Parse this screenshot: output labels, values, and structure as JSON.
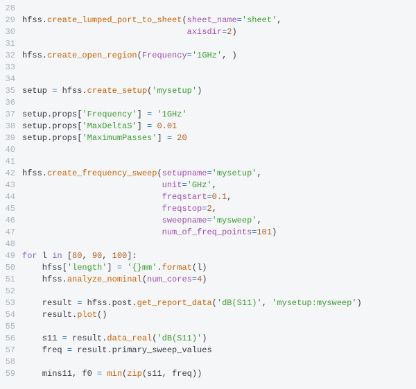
{
  "lines": [
    {
      "num": "28",
      "tokens": []
    },
    {
      "num": "29",
      "tokens": [
        {
          "c": "plain",
          "t": "hfss."
        },
        {
          "c": "fn",
          "t": "create_lumped_port_to_sheet"
        },
        {
          "c": "plain",
          "t": "("
        },
        {
          "c": "attr",
          "t": "sheet_name"
        },
        {
          "c": "op",
          "t": "="
        },
        {
          "c": "str",
          "t": "'sheet'"
        },
        {
          "c": "plain",
          "t": ","
        }
      ]
    },
    {
      "num": "30",
      "tokens": [
        {
          "c": "plain",
          "t": "                                 "
        },
        {
          "c": "attr",
          "t": "axisdir"
        },
        {
          "c": "op",
          "t": "="
        },
        {
          "c": "num",
          "t": "2"
        },
        {
          "c": "plain",
          "t": ")"
        }
      ]
    },
    {
      "num": "31",
      "tokens": []
    },
    {
      "num": "32",
      "tokens": [
        {
          "c": "plain",
          "t": "hfss."
        },
        {
          "c": "fn",
          "t": "create_open_region"
        },
        {
          "c": "plain",
          "t": "("
        },
        {
          "c": "attr",
          "t": "Frequency"
        },
        {
          "c": "op",
          "t": "="
        },
        {
          "c": "str",
          "t": "'1GHz'"
        },
        {
          "c": "plain",
          "t": ", )"
        }
      ]
    },
    {
      "num": "33",
      "tokens": []
    },
    {
      "num": "34",
      "tokens": []
    },
    {
      "num": "35",
      "tokens": [
        {
          "c": "plain",
          "t": "setup "
        },
        {
          "c": "op",
          "t": "="
        },
        {
          "c": "plain",
          "t": " hfss."
        },
        {
          "c": "fn",
          "t": "create_setup"
        },
        {
          "c": "plain",
          "t": "("
        },
        {
          "c": "str",
          "t": "'mysetup'"
        },
        {
          "c": "plain",
          "t": ")"
        }
      ]
    },
    {
      "num": "36",
      "tokens": []
    },
    {
      "num": "37",
      "tokens": [
        {
          "c": "plain",
          "t": "setup.props["
        },
        {
          "c": "str",
          "t": "'Frequency'"
        },
        {
          "c": "plain",
          "t": "] "
        },
        {
          "c": "op",
          "t": "="
        },
        {
          "c": "plain",
          "t": " "
        },
        {
          "c": "str",
          "t": "'1GHz'"
        }
      ]
    },
    {
      "num": "38",
      "tokens": [
        {
          "c": "plain",
          "t": "setup.props["
        },
        {
          "c": "str",
          "t": "'MaxDeltaS'"
        },
        {
          "c": "plain",
          "t": "] "
        },
        {
          "c": "op",
          "t": "="
        },
        {
          "c": "plain",
          "t": " "
        },
        {
          "c": "num",
          "t": "0.01"
        }
      ]
    },
    {
      "num": "39",
      "tokens": [
        {
          "c": "plain",
          "t": "setup.props["
        },
        {
          "c": "str",
          "t": "'MaximumPasses'"
        },
        {
          "c": "plain",
          "t": "] "
        },
        {
          "c": "op",
          "t": "="
        },
        {
          "c": "plain",
          "t": " "
        },
        {
          "c": "num",
          "t": "20"
        }
      ]
    },
    {
      "num": "40",
      "tokens": []
    },
    {
      "num": "41",
      "tokens": []
    },
    {
      "num": "42",
      "tokens": [
        {
          "c": "plain",
          "t": "hfss."
        },
        {
          "c": "fn",
          "t": "create_frequency_sweep"
        },
        {
          "c": "plain",
          "t": "("
        },
        {
          "c": "attr",
          "t": "setupname"
        },
        {
          "c": "op",
          "t": "="
        },
        {
          "c": "str",
          "t": "'mysetup'"
        },
        {
          "c": "plain",
          "t": ","
        }
      ]
    },
    {
      "num": "43",
      "tokens": [
        {
          "c": "plain",
          "t": "                            "
        },
        {
          "c": "attr",
          "t": "unit"
        },
        {
          "c": "op",
          "t": "="
        },
        {
          "c": "str",
          "t": "'GHz'"
        },
        {
          "c": "plain",
          "t": ","
        }
      ]
    },
    {
      "num": "44",
      "tokens": [
        {
          "c": "plain",
          "t": "                            "
        },
        {
          "c": "attr",
          "t": "freqstart"
        },
        {
          "c": "op",
          "t": "="
        },
        {
          "c": "num",
          "t": "0.1"
        },
        {
          "c": "plain",
          "t": ","
        }
      ]
    },
    {
      "num": "45",
      "tokens": [
        {
          "c": "plain",
          "t": "                            "
        },
        {
          "c": "attr",
          "t": "freqstop"
        },
        {
          "c": "op",
          "t": "="
        },
        {
          "c": "num",
          "t": "2"
        },
        {
          "c": "plain",
          "t": ","
        }
      ]
    },
    {
      "num": "46",
      "tokens": [
        {
          "c": "plain",
          "t": "                            "
        },
        {
          "c": "attr",
          "t": "sweepname"
        },
        {
          "c": "op",
          "t": "="
        },
        {
          "c": "str",
          "t": "'mysweep'"
        },
        {
          "c": "plain",
          "t": ","
        }
      ]
    },
    {
      "num": "47",
      "tokens": [
        {
          "c": "plain",
          "t": "                            "
        },
        {
          "c": "attr",
          "t": "num_of_freq_points"
        },
        {
          "c": "op",
          "t": "="
        },
        {
          "c": "num",
          "t": "101"
        },
        {
          "c": "plain",
          "t": ")"
        }
      ]
    },
    {
      "num": "48",
      "tokens": []
    },
    {
      "num": "49",
      "tokens": [
        {
          "c": "kw",
          "t": "for"
        },
        {
          "c": "plain",
          "t": " l "
        },
        {
          "c": "kw",
          "t": "in"
        },
        {
          "c": "plain",
          "t": " ["
        },
        {
          "c": "num",
          "t": "80"
        },
        {
          "c": "plain",
          "t": ", "
        },
        {
          "c": "num",
          "t": "90"
        },
        {
          "c": "plain",
          "t": ", "
        },
        {
          "c": "num",
          "t": "100"
        },
        {
          "c": "plain",
          "t": "]:"
        }
      ]
    },
    {
      "num": "50",
      "tokens": [
        {
          "c": "plain",
          "t": "    hfss["
        },
        {
          "c": "str",
          "t": "'length'"
        },
        {
          "c": "plain",
          "t": "] "
        },
        {
          "c": "op",
          "t": "="
        },
        {
          "c": "plain",
          "t": " "
        },
        {
          "c": "str",
          "t": "'{}mm'"
        },
        {
          "c": "plain",
          "t": "."
        },
        {
          "c": "builtin",
          "t": "format"
        },
        {
          "c": "plain",
          "t": "(l)"
        }
      ]
    },
    {
      "num": "51",
      "tokens": [
        {
          "c": "plain",
          "t": "    hfss."
        },
        {
          "c": "fn",
          "t": "analyze_nominal"
        },
        {
          "c": "plain",
          "t": "("
        },
        {
          "c": "attr",
          "t": "num_cores"
        },
        {
          "c": "op",
          "t": "="
        },
        {
          "c": "num",
          "t": "4"
        },
        {
          "c": "plain",
          "t": ")"
        }
      ]
    },
    {
      "num": "52",
      "tokens": []
    },
    {
      "num": "53",
      "tokens": [
        {
          "c": "plain",
          "t": "    result "
        },
        {
          "c": "op",
          "t": "="
        },
        {
          "c": "plain",
          "t": " hfss.post."
        },
        {
          "c": "fn",
          "t": "get_report_data"
        },
        {
          "c": "plain",
          "t": "("
        },
        {
          "c": "str",
          "t": "'dB(S11)'"
        },
        {
          "c": "plain",
          "t": ", "
        },
        {
          "c": "str",
          "t": "'mysetup:mysweep'"
        },
        {
          "c": "plain",
          "t": ")"
        }
      ]
    },
    {
      "num": "54",
      "tokens": [
        {
          "c": "plain",
          "t": "    result."
        },
        {
          "c": "fn",
          "t": "plot"
        },
        {
          "c": "plain",
          "t": "()"
        }
      ]
    },
    {
      "num": "55",
      "tokens": []
    },
    {
      "num": "56",
      "tokens": [
        {
          "c": "plain",
          "t": "    s11 "
        },
        {
          "c": "op",
          "t": "="
        },
        {
          "c": "plain",
          "t": " result."
        },
        {
          "c": "fn",
          "t": "data_real"
        },
        {
          "c": "plain",
          "t": "("
        },
        {
          "c": "str",
          "t": "'dB(S11)'"
        },
        {
          "c": "plain",
          "t": ")"
        }
      ]
    },
    {
      "num": "57",
      "tokens": [
        {
          "c": "plain",
          "t": "    freq "
        },
        {
          "c": "op",
          "t": "="
        },
        {
          "c": "plain",
          "t": " result.primary_sweep_values"
        }
      ]
    },
    {
      "num": "58",
      "tokens": []
    },
    {
      "num": "59",
      "tokens": [
        {
          "c": "plain",
          "t": "    mins11, f0 "
        },
        {
          "c": "op",
          "t": "="
        },
        {
          "c": "plain",
          "t": " "
        },
        {
          "c": "builtin",
          "t": "min"
        },
        {
          "c": "plain",
          "t": "("
        },
        {
          "c": "builtin",
          "t": "zip"
        },
        {
          "c": "plain",
          "t": "(s11, freq))"
        }
      ]
    }
  ]
}
